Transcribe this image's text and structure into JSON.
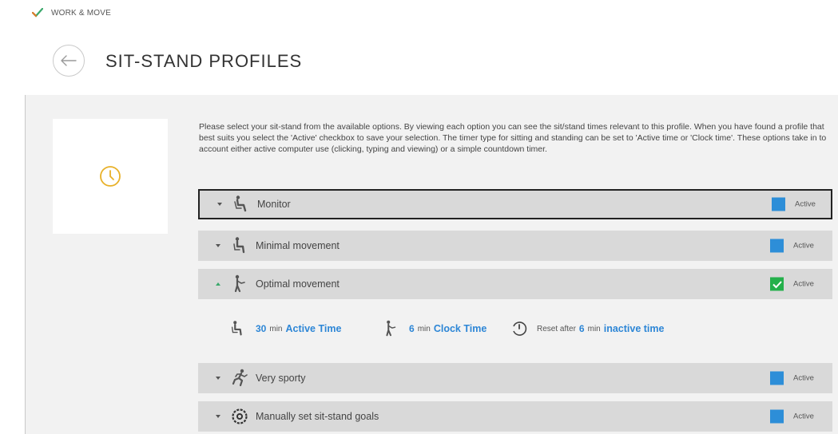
{
  "app": {
    "name": "WORK & MOVE",
    "logo_icon": "checkmark-logo-icon"
  },
  "header": {
    "title": "SIT-STAND PROFILES",
    "back_icon": "back-arrow-icon"
  },
  "panel": {
    "icon": "clock-icon",
    "icon_color": "#e8b12a"
  },
  "intro_text": "Please select your sit-stand from the available options. By viewing each option you can see the sit/stand times relevant to this profile. When you have found a profile that best suits you select the 'Active' checkbox to save your selection. The timer type for sitting and standing can be set to 'Active time or 'Clock time'. These options take in to account either active computer use (clicking, typing and viewing) or a simple countdown timer.",
  "profiles": [
    {
      "label": "Monitor",
      "icon": "sitting-person-icon",
      "active_label": "Active",
      "checked": false,
      "expanded": false
    },
    {
      "label": "Minimal movement",
      "icon": "sitting-person-icon",
      "active_label": "Active",
      "checked": false,
      "expanded": false
    },
    {
      "label": "Optimal movement",
      "icon": "standing-person-icon",
      "active_label": "Active",
      "checked": true,
      "expanded": true
    },
    {
      "label": "Very sporty",
      "icon": "running-person-icon",
      "active_label": "Active",
      "checked": false,
      "expanded": false
    },
    {
      "label": "Manually set sit-stand goals",
      "icon": "settings-gear-icon",
      "active_label": "Active",
      "checked": false,
      "expanded": false
    }
  ],
  "details": {
    "sit": {
      "value": "30",
      "unit": "min",
      "type": "Active Time",
      "icon": "sitting-person-icon"
    },
    "stand": {
      "value": "6",
      "unit": "min",
      "type": "Clock Time",
      "icon": "standing-person-icon"
    },
    "reset": {
      "prefix": "Reset after",
      "value": "6",
      "unit": "min",
      "type": "inactive time",
      "icon": "reset-timer-icon"
    }
  },
  "colors": {
    "accent": "#2d86d6",
    "checkbox": "#2d8ed8",
    "checked": "#24b04b",
    "row_bg": "#d9d9d9",
    "content_bg": "#f2f2f2"
  }
}
